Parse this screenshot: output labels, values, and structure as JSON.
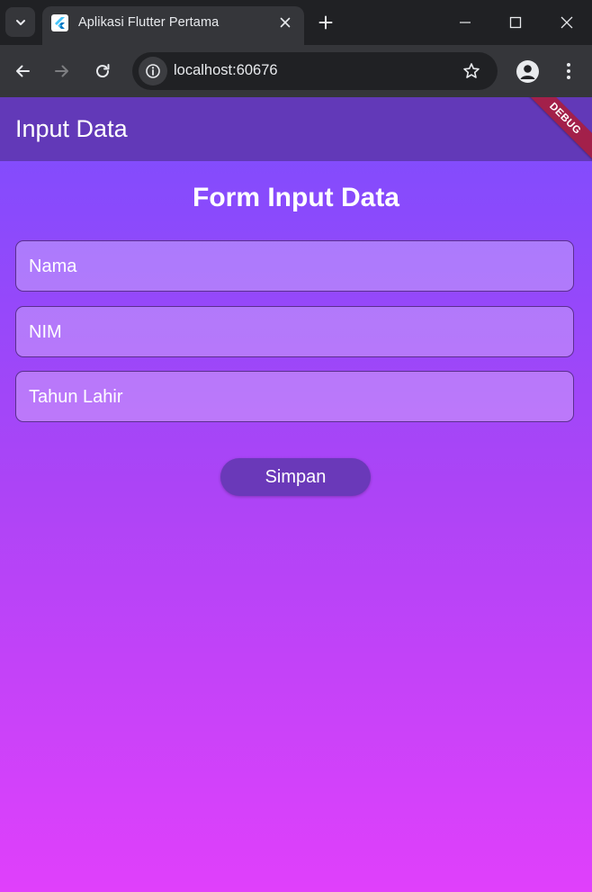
{
  "browser": {
    "tab_title": "Aplikasi Flutter Pertama",
    "url": "localhost:60676"
  },
  "app": {
    "appbar_title": "Input Data",
    "debug_banner": "DEBUG",
    "form_title": "Form Input Data",
    "fields": [
      {
        "label": "Nama"
      },
      {
        "label": "NIM"
      },
      {
        "label": "Tahun Lahir"
      }
    ],
    "save_label": "Simpan"
  },
  "colors": {
    "appbar": "#6239b8",
    "gradient_top": "#7c4dfe",
    "gradient_bottom": "#e040fb",
    "button": "#6a39b9",
    "debug_banner": "#a3204a"
  },
  "icons": {
    "tab_search": "chevron-down-icon",
    "favicon": "flutter-icon",
    "tab_close": "close-icon",
    "new_tab": "plus-icon",
    "minimize": "minimize-icon",
    "maximize": "maximize-icon",
    "window_close": "close-icon",
    "back": "arrow-left-icon",
    "forward": "arrow-right-icon",
    "reload": "reload-icon",
    "site_info": "info-icon",
    "bookmark": "star-icon",
    "profile": "person-icon",
    "menu": "more-vertical-icon"
  }
}
